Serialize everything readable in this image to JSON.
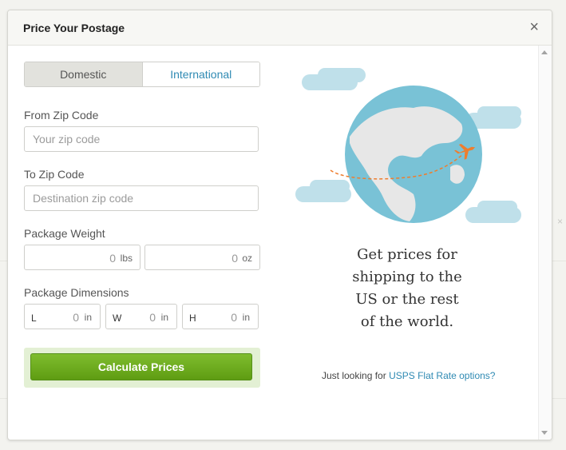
{
  "modal": {
    "title": "Price Your Postage",
    "close_icon": "close-icon"
  },
  "tabs": {
    "domestic": "Domestic",
    "international": "International",
    "active": "Domestic"
  },
  "fields": {
    "from_zip": {
      "label": "From Zip Code",
      "placeholder": "Your zip code"
    },
    "to_zip": {
      "label": "To Zip Code",
      "placeholder": "Destination zip code"
    },
    "weight": {
      "label": "Package Weight",
      "lbs_value": "0",
      "lbs_unit": "lbs",
      "oz_value": "0",
      "oz_unit": "oz"
    },
    "dimensions": {
      "label": "Package Dimensions",
      "length": {
        "letter": "L",
        "value": "0",
        "unit": "in"
      },
      "width": {
        "letter": "W",
        "value": "0",
        "unit": "in"
      },
      "height": {
        "letter": "H",
        "value": "0",
        "unit": "in"
      }
    }
  },
  "calculate_button": "Calculate Prices",
  "promo": {
    "text": "Get prices for shipping to the US or the rest of the world.",
    "flat_prefix": "Just looking for",
    "flat_link": "USPS Flat Rate options?"
  },
  "colors": {
    "accent_link": "#2f8ab3",
    "button_green": "#6aa81f",
    "globe_water": "#79c2d6",
    "plane_orange": "#ef7d2d"
  }
}
